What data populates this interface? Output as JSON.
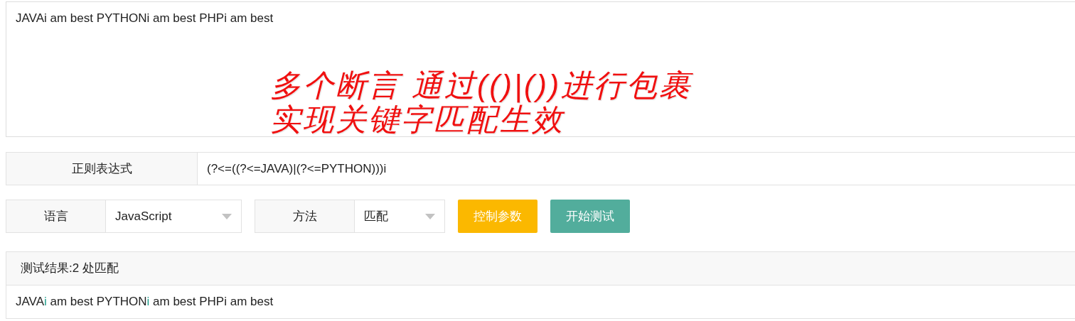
{
  "source_text": {
    "value": "JAVAi am best PYTHONi am best PHPi am best"
  },
  "annotation": {
    "lines": [
      "多个断言 通过(()|())进行包裹",
      "实现关键字匹配生效"
    ]
  },
  "regex": {
    "label": "正则表达式",
    "value": "(?<=((?<=JAVA)|(?<=PYTHON)))i"
  },
  "options": [
    {
      "label": "语言",
      "value": "JavaScript"
    },
    {
      "label": "方法",
      "value": "匹配"
    }
  ],
  "buttons": [
    {
      "label": "控制参数",
      "kind": "warning"
    },
    {
      "label": "开始测试",
      "kind": "success"
    }
  ],
  "result": {
    "title": "测试结果:2 处匹配",
    "segments": [
      {
        "text": "JAVA",
        "match": false
      },
      {
        "text": "i",
        "match": true
      },
      {
        "text": " am best PYTHON",
        "match": false
      },
      {
        "text": "i",
        "match": true
      },
      {
        "text": " am best PHPi am best",
        "match": false
      }
    ]
  }
}
